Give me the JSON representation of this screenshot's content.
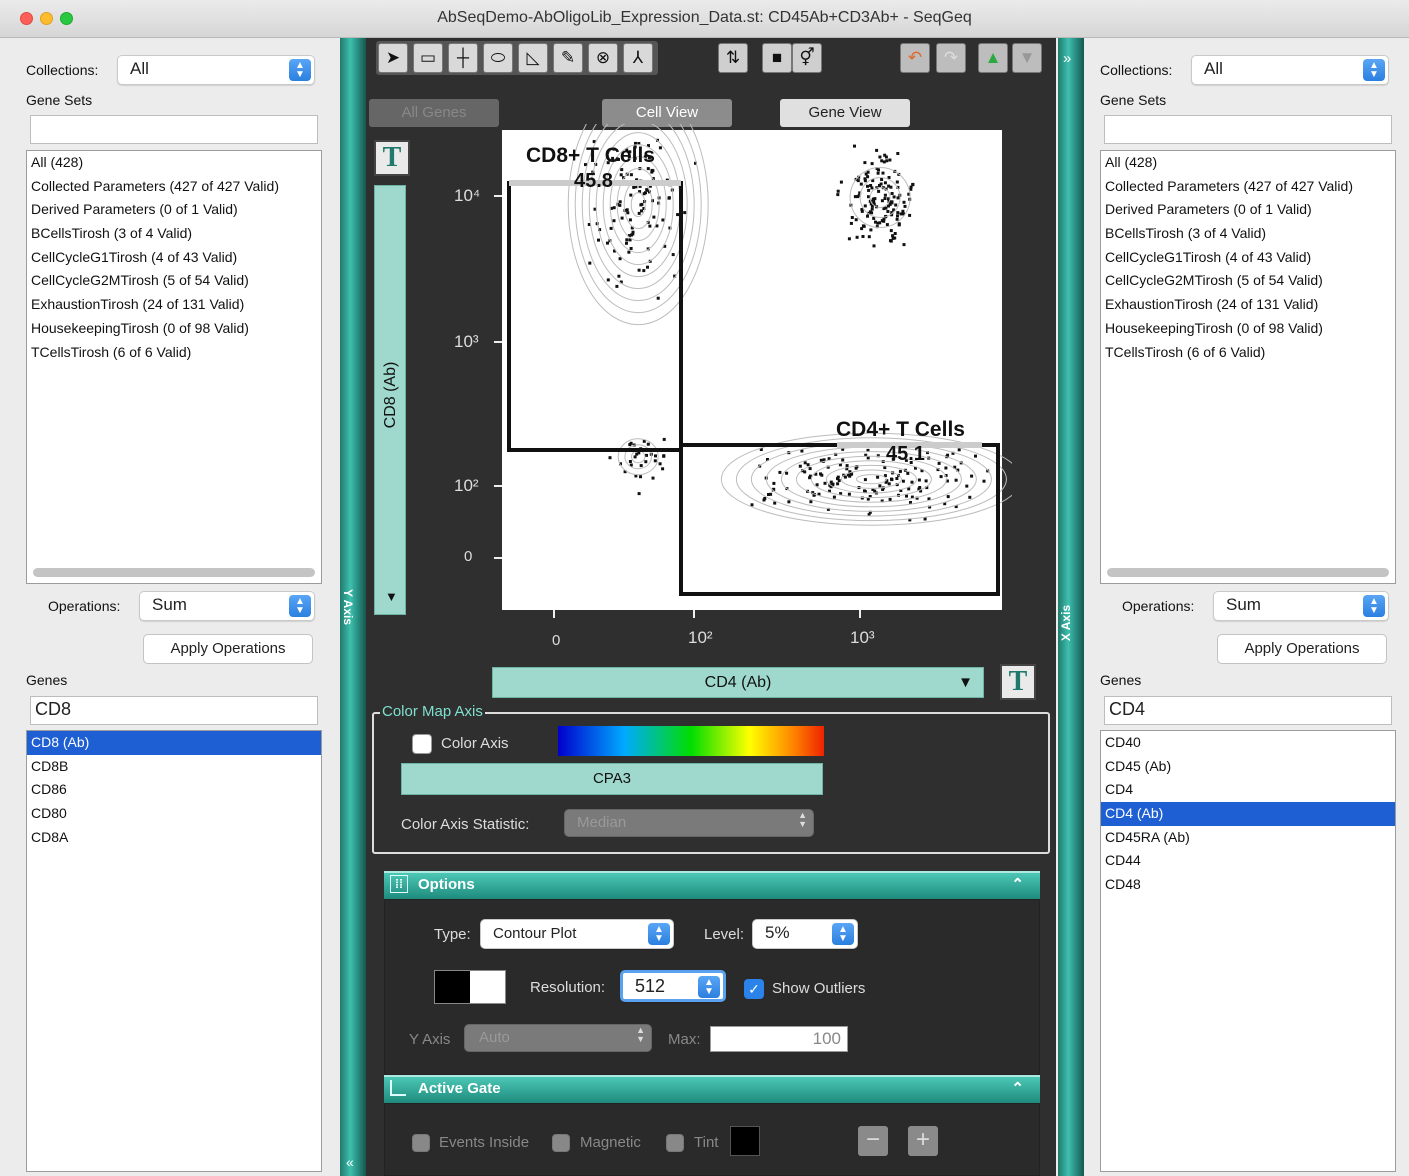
{
  "window": {
    "title": "AbSeqDemo-AbOligoLib_Expression_Data.st: CD45Ab+CD3Ab+ - SeqGeq"
  },
  "left_panel": {
    "collections_label": "Collections:",
    "collections_value": "All",
    "gene_sets_label": "Gene Sets",
    "gene_sets_filter": "",
    "gene_sets": [
      "All (428)",
      "Collected Parameters (427 of 427 Valid)",
      "Derived Parameters (0 of 1 Valid)",
      "BCellsTirosh (3 of 4 Valid)",
      "CellCycleG1Tirosh (4 of 43 Valid)",
      "CellCycleG2MTirosh (5 of 54 Valid)",
      "ExhaustionTirosh (24 of 131 Valid)",
      "HousekeepingTirosh (0 of 98 Valid)",
      "TCellsTirosh (6 of 6 Valid)"
    ],
    "operations_label": "Operations:",
    "operations_value": "Sum",
    "apply_label": "Apply Operations",
    "genes_label": "Genes",
    "genes_filter": "CD8",
    "genes": [
      "CD8 (Ab)",
      "CD8B",
      "CD86",
      "CD80",
      "CD8A"
    ],
    "selected_gene": "CD8 (Ab)"
  },
  "right_panel": {
    "collections_label": "Collections:",
    "collections_value": "All",
    "gene_sets_label": "Gene Sets",
    "gene_sets_filter": "",
    "gene_sets": [
      "All (428)",
      "Collected Parameters (427 of 427 Valid)",
      "Derived Parameters (0 of 1 Valid)",
      "BCellsTirosh (3 of 4 Valid)",
      "CellCycleG1Tirosh (4 of 43 Valid)",
      "CellCycleG2MTirosh (5 of 54 Valid)",
      "ExhaustionTirosh (24 of 131 Valid)",
      "HousekeepingTirosh (0 of 98 Valid)",
      "TCellsTirosh (6 of 6 Valid)"
    ],
    "operations_label": "Operations:",
    "operations_value": "Sum",
    "apply_label": "Apply Operations",
    "genes_label": "Genes",
    "genes_filter": "CD4",
    "genes": [
      "CD40",
      "CD45 (Ab)",
      "CD4",
      "CD4 (Ab)",
      "CD45RA (Ab)",
      "CD44",
      "CD48"
    ],
    "selected_gene": "CD4 (Ab)"
  },
  "side_bars": {
    "y_axis_label": "Y Axis",
    "x_axis_label": "X Axis",
    "expand_right_glyph": "»",
    "collapse_left_glyph": "«"
  },
  "toolbar": {
    "tools": [
      "pointer-tool-icon",
      "rectangle-gate-icon",
      "quadrant-gate-icon",
      "ellipse-gate-icon",
      "polygon-gate-icon",
      "freehand-gate-icon",
      "spider-gate-icon",
      "curly-quad-icon"
    ],
    "tool_glyphs": [
      "➤",
      "▭",
      "┼",
      "⬭",
      "◺",
      "✎",
      "⊗",
      "⅄"
    ]
  },
  "view_tabs": {
    "all_genes": "All Genes",
    "cell_view": "Cell View",
    "gene_view": "Gene View"
  },
  "plot": {
    "y_parameter": "CD8 (Ab)",
    "x_parameter": "CD4 (Ab)",
    "t_button": "T",
    "gates": [
      {
        "name": "CD8+ T Cells",
        "percent": "45.8"
      },
      {
        "name": "CD4+ T Cells",
        "percent": "45.1"
      }
    ],
    "y_ticks": [
      "10⁴",
      "10³",
      "10²",
      "0"
    ],
    "x_ticks": [
      "0",
      "10²",
      "10³"
    ]
  },
  "chart_data": {
    "type": "scatter",
    "subtype": "contour plot with outliers",
    "title": "",
    "xlabel": "CD4 (Ab)",
    "ylabel": "CD8 (Ab)",
    "x_scale": "biexponential",
    "y_scale": "biexponential",
    "x_tick_labels": [
      "0",
      "10^2",
      "10^3"
    ],
    "y_tick_labels": [
      "0",
      "10^2",
      "10^3",
      "10^4"
    ],
    "gates": [
      {
        "name": "CD8+ T Cells",
        "percent": 45.8,
        "x_range": [
          -30,
          80
        ],
        "y_range": [
          150,
          12000
        ]
      },
      {
        "name": "CD4+ T Cells",
        "percent": 45.1,
        "x_range": [
          80,
          5000
        ],
        "y_range": [
          -30,
          150
        ]
      }
    ],
    "populations": [
      {
        "name": "CD8+ cluster",
        "x_center": 5,
        "y_center": 3000
      },
      {
        "name": "CD4+ cluster",
        "x_center": 1000,
        "y_center": 5
      },
      {
        "name": "double-positive cluster",
        "x_center": 1200,
        "y_center": 3500
      },
      {
        "name": "double-negative cluster",
        "x_center": 5,
        "y_center": 10
      }
    ]
  },
  "color_map": {
    "section_label": "Color Map Axis",
    "color_axis_label": "Color Axis",
    "color_axis_checked": false,
    "parameter": "CPA3",
    "statistic_label": "Color Axis Statistic:",
    "statistic_value": "Median",
    "gradient_colors": [
      "#0000cc",
      "#00aaff",
      "#00dd00",
      "#ffff00",
      "#ff8800",
      "#ee2200"
    ]
  },
  "options": {
    "section_label": "Options",
    "type_label": "Type:",
    "type_value": "Contour Plot",
    "level_label": "Level:",
    "level_value": "5%",
    "resolution_label": "Resolution:",
    "resolution_value": "512",
    "show_outliers_label": "Show Outliers",
    "show_outliers_checked": true,
    "y_axis_label": "Y Axis",
    "y_axis_value": "Auto",
    "max_label": "Max:",
    "max_value": "100"
  },
  "active_gate": {
    "section_label": "Active Gate",
    "events_inside_label": "Events Inside",
    "magnetic_label": "Magnetic",
    "tint_label": "Tint",
    "minus_glyph": "−",
    "plus_glyph": "+"
  },
  "colors": {
    "teal_accent": "#3fbfae",
    "selection_blue": "#1e5fd4",
    "center_bg": "#2f2f2f"
  }
}
